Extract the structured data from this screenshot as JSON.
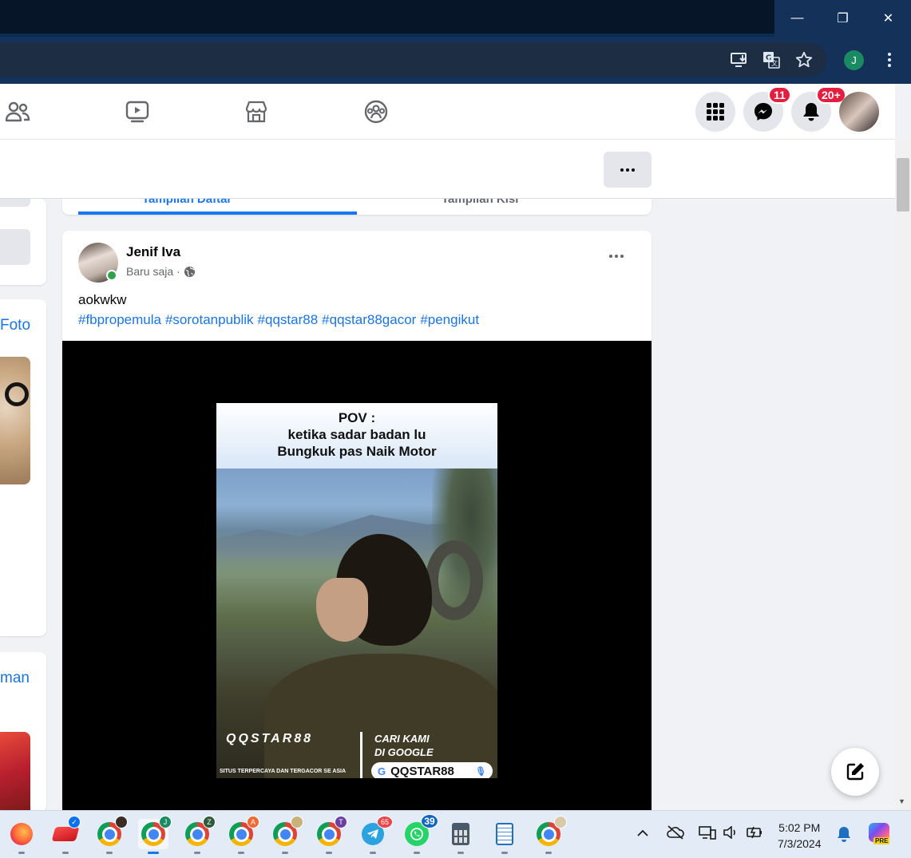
{
  "window": {
    "minimize": "—",
    "restore": "❐",
    "close": "✕"
  },
  "browser": {
    "profile_initial": "J"
  },
  "nav": {
    "messenger_badge": "11",
    "notifications_badge": "20+"
  },
  "left_sidebar": {
    "photo_link": "Foto",
    "second_link": "man"
  },
  "tabs": {
    "list_view": "Tampilan Daftar",
    "grid_view": "Tampilan Kisi"
  },
  "post": {
    "author": "Jenif Iva",
    "time": "Baru saja",
    "separator": "·",
    "text": "aokwkw",
    "hashtags": [
      "#fbpropemula",
      "#sorotanpublik",
      "#qqstar88",
      "#qqstar88gacor",
      "#pengikut"
    ]
  },
  "video": {
    "caption_line1": "POV :",
    "caption_line2": "ketika sadar badan lu",
    "caption_line3": "Bungkuk pas Naik Motor",
    "logo": "QQSTAR88",
    "logo_tagline": "SITUS TERPERCAYA DAN TERGACOR SE ASIA",
    "search_hint_line1": "CARI KAMI",
    "search_hint_line2": "DI GOOGLE",
    "search_text": "QQSTAR88"
  },
  "taskbar": {
    "telegram_badge": "65",
    "whatsapp_badge": "39",
    "chrome_z": "Z",
    "chrome_a": "A",
    "chrome_t": "T",
    "chrome_j": "J",
    "copilot_tag": "PRE",
    "time": "5:02 PM",
    "date": "7/3/2024"
  },
  "colors": {
    "fb_blue": "#1877f2",
    "badge_red": "#e41e3f",
    "online_green": "#31a24c",
    "hashtag": "#1b74e4"
  }
}
